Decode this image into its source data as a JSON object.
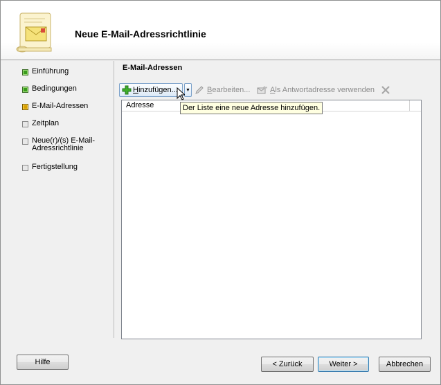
{
  "wizard": {
    "title": "Neue E-Mail-Adressrichtlinie"
  },
  "steps": [
    {
      "label": "Einführung",
      "state": "done"
    },
    {
      "label": "Bedingungen",
      "state": "done"
    },
    {
      "label": "E-Mail-Adressen",
      "state": "current"
    },
    {
      "label": "Zeitplan",
      "state": "todo"
    },
    {
      "label": "Neue(r)/(s) E-Mail-Adressrichtlinie",
      "state": "todo"
    },
    {
      "label": "Fertigstellung",
      "state": "todo"
    }
  ],
  "section": {
    "title": "E-Mail-Adressen"
  },
  "toolbar": {
    "add": "Hinzufügen...",
    "edit": "Bearbeiten...",
    "reply": "Als Antwortadresse verwenden"
  },
  "table": {
    "columns": [
      "Adresse"
    ],
    "rows": []
  },
  "tooltip": "Der Liste eine neue Adresse hinzufügen.",
  "buttons": {
    "help": "Hilfe",
    "back": "< Zurück",
    "next": "Weiter >",
    "cancel": "Abbrechen"
  },
  "colors": {
    "step_done": "#3a9d1c",
    "step_current": "#d9a000",
    "tooltip_bg": "#ffffe1"
  }
}
